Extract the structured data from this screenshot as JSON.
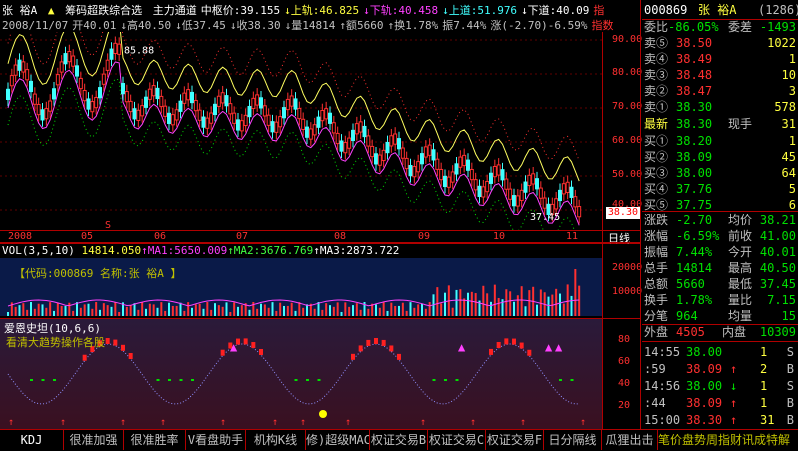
{
  "header": {
    "stock_name": "张  裕A",
    "indicator_name": "筹码超跌综合选",
    "items": [
      {
        "label": "主力通道",
        "color": "#ffffff"
      },
      {
        "label": "中枢价:39.155",
        "color": "#ffffff"
      },
      {
        "label": "↓上轨:46.825",
        "color": "#ffff40"
      },
      {
        "label": "↓下轨:40.458",
        "color": "#ff40ff"
      },
      {
        "label": "↓上道:51.976",
        "color": "#40ffff"
      },
      {
        "label": "↓下道:40.09",
        "color": "#ffffff"
      },
      {
        "label": "指",
        "color": "#ff3030"
      }
    ],
    "line2": [
      {
        "label": "2008/11/07",
        "color": "#c0c0c0"
      },
      {
        "label": "开40.01",
        "color": "#c0c0c0"
      },
      {
        "label": "↓高40.50",
        "color": "#c0c0c0"
      },
      {
        "label": "↓低37.45",
        "color": "#c0c0c0"
      },
      {
        "label": "↓收38.30",
        "color": "#c0c0c0"
      },
      {
        "label": "↓量14814",
        "color": "#c0c0c0"
      },
      {
        "label": "↑额5660",
        "color": "#c0c0c0"
      },
      {
        "label": "↑换1.78%",
        "color": "#c0c0c0"
      },
      {
        "label": "振7.44%",
        "color": "#c0c0c0"
      },
      {
        "label": "涨(-2.70)-6.59%",
        "color": "#c0c0c0"
      },
      {
        "label": "指数",
        "color": "#ff3030"
      }
    ]
  },
  "price_chart": {
    "y_ticks": [
      "90.00",
      "80.00",
      "70.00",
      "60.00",
      "50.00",
      "40.00"
    ],
    "current_price_tag": "38.30",
    "high_annotation": "85.88",
    "low_annotation": "37.45",
    "date_labels": [
      "2008",
      "05",
      "06",
      "07",
      "08",
      "09",
      "10",
      "11"
    ],
    "period_label": "日线",
    "marker_s": "S"
  },
  "volume_panel": {
    "title": "VOL(3,5,10)",
    "values": [
      {
        "label": "14814.050",
        "color": "#ffff40"
      },
      {
        "label": "↑MA1:5650.009",
        "color": "#ff40ff"
      },
      {
        "label": "↑MA2:3676.769",
        "color": "#40ff40"
      },
      {
        "label": "↑MA3:2873.722",
        "color": "#ffffff"
      }
    ],
    "code_label": "【代码:000869 名称:张  裕A 】",
    "y_ticks": [
      "20000",
      "10000"
    ]
  },
  "indicator_panel": {
    "title": "爱恩史坦(10,6,6)",
    "subtitle": "看清大趋势操作各股",
    "y_ticks": [
      "80",
      "60",
      "40",
      "20"
    ]
  },
  "quotes": {
    "code": "000869",
    "name": "张  裕A",
    "ticker_num": "(1286)",
    "weibi_label": "委比",
    "weibi_value": "-86.05%",
    "weicha_label": "委差",
    "weicha_value": "-1493",
    "sells": [
      {
        "label": "卖⑤",
        "price": "38.50",
        "vol": "1022"
      },
      {
        "label": "卖④",
        "price": "38.49",
        "vol": "1"
      },
      {
        "label": "卖③",
        "price": "38.48",
        "vol": "10"
      },
      {
        "label": "卖②",
        "price": "38.47",
        "vol": "3"
      },
      {
        "label": "卖①",
        "price": "38.30",
        "vol": "578"
      }
    ],
    "latest_label": "最新",
    "latest_value": "38.30",
    "xianshou_label": "现手",
    "xianshou_value": "31",
    "buys": [
      {
        "label": "买①",
        "price": "38.20",
        "vol": "1"
      },
      {
        "label": "买②",
        "price": "38.09",
        "vol": "45"
      },
      {
        "label": "买③",
        "price": "38.00",
        "vol": "64"
      },
      {
        "label": "买④",
        "price": "37.76",
        "vol": "5"
      },
      {
        "label": "买⑤",
        "price": "37.75",
        "vol": "6"
      }
    ],
    "stats": [
      {
        "l1": "涨跌",
        "v1": "-2.70",
        "l2": "均价",
        "v2": "38.21"
      },
      {
        "l1": "涨幅",
        "v1": "-6.59%",
        "l2": "前收",
        "v2": "41.00"
      },
      {
        "l1": "振幅",
        "v1": "7.44%",
        "l2": "今开",
        "v2": "40.01"
      },
      {
        "l1": "总手",
        "v1": "14814",
        "l2": "最高",
        "v2": "40.50"
      },
      {
        "l1": "总额",
        "v1": "5660",
        "l2": "最低",
        "v2": "37.45"
      },
      {
        "l1": "换手",
        "v1": "1.78%",
        "l2": "量比",
        "v2": "7.15"
      },
      {
        "l1": "分笔",
        "v1": "964",
        "l2": "均量",
        "v2": "15"
      }
    ],
    "waipan_label": "外盘",
    "waipan_value": "4505",
    "neipan_label": "内盘",
    "neipan_value": "10309",
    "ticks": [
      {
        "time": "14:55",
        "price": "38.00",
        "arrow": "",
        "vol": "1",
        "side": "S"
      },
      {
        "time": ":59",
        "price": "38.09",
        "arrow": "↑",
        "vol": "2",
        "side": "B"
      },
      {
        "time": "14:56",
        "price": "38.00",
        "arrow": "↓",
        "vol": "1",
        "side": "S"
      },
      {
        "time": ":44",
        "price": "38.09",
        "arrow": "↑",
        "vol": "1",
        "side": "B"
      },
      {
        "time": "15:00",
        "price": "38.30",
        "arrow": "↑",
        "vol": "31",
        "side": "B"
      }
    ]
  },
  "tabs": [
    {
      "label": "KDJ"
    },
    {
      "label": "很准加强"
    },
    {
      "label": "很准胜率"
    },
    {
      "label": "V看盘助手"
    },
    {
      "label": "机构K线"
    },
    {
      "label": "修)超级MACD"
    },
    {
      "label": "权证交易B"
    },
    {
      "label": "权证交易C"
    },
    {
      "label": "权证交易F"
    },
    {
      "label": "日分隔线"
    },
    {
      "label": "瓜狸出击"
    }
  ],
  "right_tabs": [
    "笔",
    "价",
    "盘",
    "势",
    "周",
    "指",
    "财",
    "讯",
    "成",
    "特",
    "解"
  ]
}
